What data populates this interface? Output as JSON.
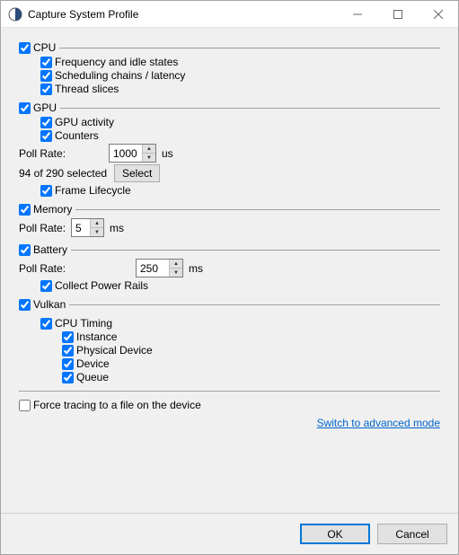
{
  "window": {
    "title": "Capture System Profile"
  },
  "cpu": {
    "label": "CPU",
    "freq": "Frequency and idle states",
    "sched": "Scheduling chains / latency",
    "slices": "Thread slices"
  },
  "gpu": {
    "label": "GPU",
    "activity": "GPU activity",
    "counters": "Counters",
    "poll_label": "Poll Rate:",
    "poll_value": "1000",
    "poll_unit": "us",
    "selected_text": "94 of 290 selected",
    "select_btn": "Select",
    "frame": "Frame Lifecycle"
  },
  "memory": {
    "label": "Memory",
    "poll_label": "Poll Rate:",
    "poll_value": "5",
    "poll_unit": "ms"
  },
  "battery": {
    "label": "Battery",
    "poll_label": "Poll Rate:",
    "poll_value": "250",
    "poll_unit": "ms",
    "rails": "Collect Power Rails"
  },
  "vulkan": {
    "label": "Vulkan",
    "cpu_timing": "CPU Timing",
    "instance": "Instance",
    "physical": "Physical Device",
    "device": "Device",
    "queue": "Queue"
  },
  "force_trace": "Force tracing to a file on the device",
  "advanced_link": "Switch to advanced mode",
  "buttons": {
    "ok": "OK",
    "cancel": "Cancel"
  }
}
